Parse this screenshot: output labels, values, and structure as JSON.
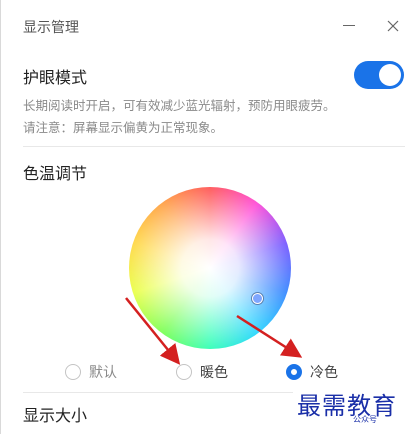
{
  "window": {
    "title": "显示管理"
  },
  "eye_care": {
    "title": "护眼模式",
    "enabled": true,
    "desc_line1": "长期阅读时开启，可有效减少蓝光辐射，预防用眼疲劳。",
    "desc_line2": "请注意：屏幕显示偏黄为正常现象。"
  },
  "color_temp": {
    "title": "色温调节",
    "options": [
      {
        "label": "默认",
        "selected": false
      },
      {
        "label": "暖色",
        "selected": false
      },
      {
        "label": "冷色",
        "selected": true
      }
    ]
  },
  "display_size": {
    "title": "显示大小"
  },
  "watermark": {
    "text": "最需教育",
    "sub": "公众号"
  },
  "colors": {
    "accent": "#1a73e8",
    "arrow": "#d42020"
  }
}
